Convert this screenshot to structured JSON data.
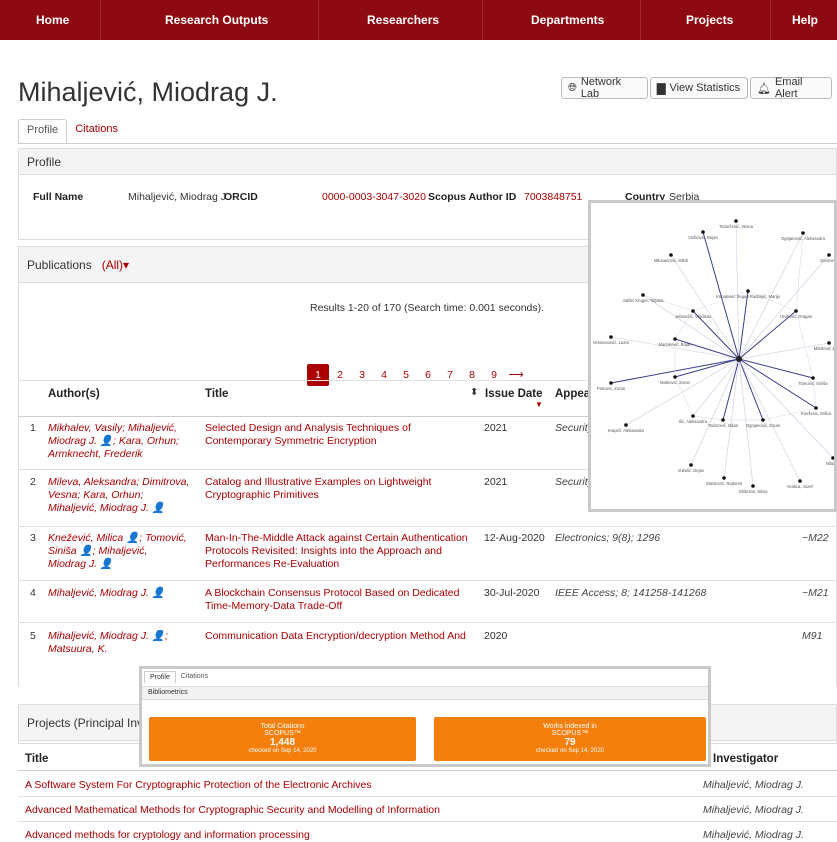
{
  "nav": [
    "Home",
    "Research Outputs",
    "Researchers",
    "Departments",
    "Projects",
    "Help"
  ],
  "page_title": "Mihaljević, Miodrag J.",
  "buttons": {
    "network": "Network Lab",
    "stats": "View Statistics",
    "alert": "Email Alert"
  },
  "tabs": [
    "Profile",
    "Citations"
  ],
  "profile": {
    "heading": "Profile",
    "full_name_label": "Full Name",
    "full_name": "Mihaljević, Miodrag J.",
    "orcid_label": "ORCID",
    "orcid": "0000-0003-3047-3020",
    "scopus_label": "Scopus Author ID",
    "scopus": "7003848751",
    "country_label": "Country",
    "country": "Serbia"
  },
  "publications": {
    "heading": "Publications",
    "filter": "(All)▾",
    "results": "Results 1-20 of 170 (Search time: 0.001 seconds).",
    "pages": [
      "1",
      "2",
      "3",
      "4",
      "5",
      "6",
      "7",
      "8",
      "9",
      "⟶"
    ],
    "columns": [
      "Author(s)",
      "Title",
      "Issue Date",
      "Appear"
    ],
    "rows": [
      {
        "n": "1",
        "authors": "Mikhalev, Vasily; Mihaljević, Miodrag J. 👤; Kara, Orhun; Armknecht, Frederik",
        "title": "Selected Design and Analysis Techniques of Contemporary Symmetric Encryption",
        "date": "2021",
        "appears": "Security",
        "cat": ""
      },
      {
        "n": "2",
        "authors": "Mileva, Aleksandra; Dimitrova, Vesna; Kara, Orhun; Mihaljević, Miodrag J. 👤",
        "title": "Catalog and Illustrative Examples on Lightweight Cryptographic Primitives",
        "date": "2021",
        "appears": "Security",
        "cat": ""
      },
      {
        "n": "3",
        "authors": "Knežević, Milica 👤; Tomović, Siniša 👤; Mihaljević, Miodrag J. 👤",
        "title": "Man-In-The-Middle Attack against Certain Authentication Protocols Revisited: Insights into the Approach and Performances Re-Evaluation",
        "date": "12-Aug-2020",
        "appears": "Electronics; 9(8); 1296",
        "cat": "~M22"
      },
      {
        "n": "4",
        "authors": "Mihaljević, Miodrag J. 👤",
        "title": "A Blockchain Consensus Protocol Based on Dedicated Time-Memory-Data Trade-Off",
        "date": "30-Jul-2020",
        "appears": "IEEE Access; 8; 141258-141268",
        "cat": "~M21"
      },
      {
        "n": "5",
        "authors": "Mihaljević, Miodrag J. 👤; Matsuura, K.",
        "title": "Communication Data Encryption/decryption Method And",
        "date": "2020",
        "appears": "",
        "cat": "M91"
      }
    ]
  },
  "projects": {
    "heading": "Projects (Principal Inv",
    "col_title": "Title",
    "col_inv": "Investigator",
    "rows": [
      {
        "title": "A Software System For Cryptographic Protection of the Electronic Archives",
        "inv": "Mihaljević, Miodrag J."
      },
      {
        "title": "Advanced Mathematical Methods for Cryptographic Security and Modelling of Information",
        "inv": "Mihaljević, Miodrag J."
      },
      {
        "title": "Advanced methods for cryptology and information processing",
        "inv": "Mihaljević, Miodrag J."
      }
    ]
  },
  "network_nodes": [
    "Todorčević, Vesna",
    "Vučković, Bojan",
    "Ognjanović, Aleksandra",
    "Milovanović, Miloš",
    "Jovanović",
    "Jakšić Kruger, Tatjana",
    "Kunaković Šegan Radonjić, Marija",
    "Jelisavčić, Vladisav",
    "Urošević, Dragan",
    "Vesovanović, Lazar",
    "Marinković, Bojan",
    "Petrović, Zoran",
    "Marković, Zoran",
    "Tomović, Siniša",
    "Kneževic, Milica",
    "Milošević Jelena",
    "Ilić, Aleksandra",
    "Todorović, Milan",
    "Ognjanović, Zoran",
    "Krapež, Aleksandar",
    "Vukelić, Dejan",
    "Stanković, Radomir",
    "Ghilezan, Silvia",
    "Kratica, Jozef",
    "Mladen"
  ],
  "bibliometrics": {
    "tabs": [
      "Profile",
      "Citations"
    ],
    "heading": "Bibliometrics",
    "box1": {
      "label1": "Total Citations",
      "label2": "SCOPUS™",
      "value": "1,448",
      "checked": "checked on Sep 14, 2020"
    },
    "box2": {
      "label1": "Works indexed in",
      "label2": "SCOPUS™",
      "value": "79",
      "checked": "checked on Sep 14, 2020"
    }
  }
}
